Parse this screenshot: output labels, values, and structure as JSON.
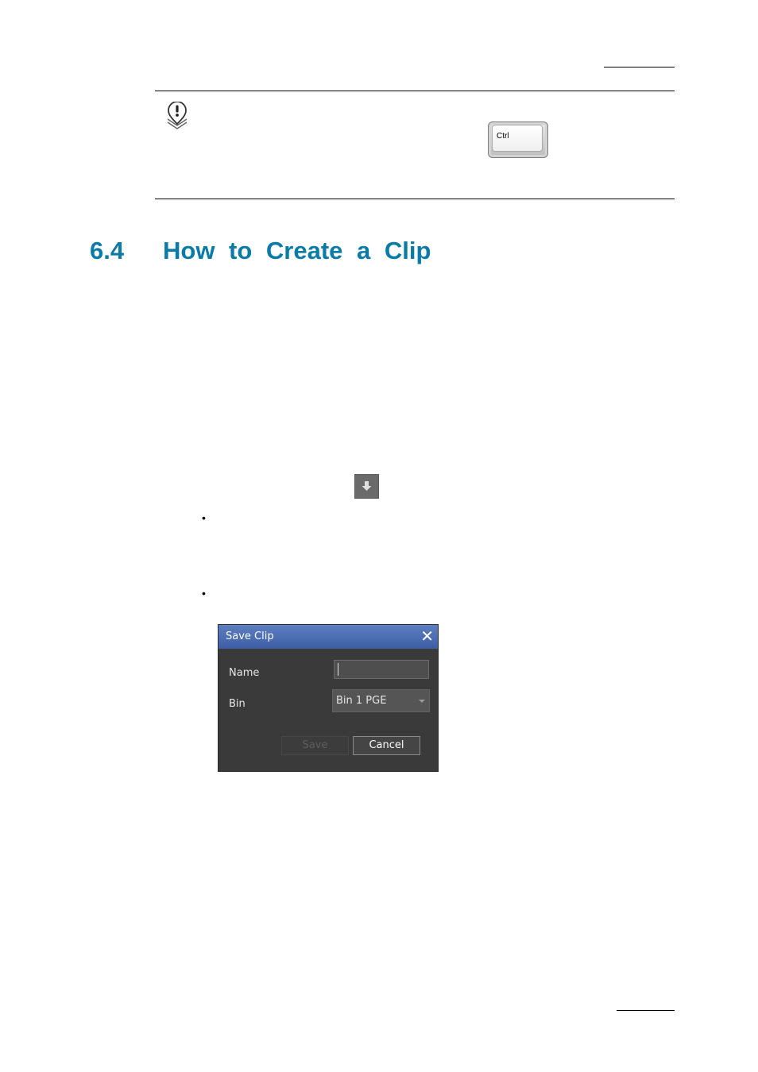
{
  "note": {
    "icon": "note-icon",
    "key_label": "Ctrl"
  },
  "section": {
    "number": "6.4",
    "title": "How to Create a Clip"
  },
  "body": {
    "inline_button_icon": "arrow-down-icon",
    "bullets": [
      "•",
      "•"
    ]
  },
  "dialog": {
    "title": "Save Clip",
    "close_glyph": "✕",
    "name_label": "Name",
    "name_value": "",
    "bin_label": "Bin",
    "bin_value": "Bin 1 PGE",
    "save_label": "Save",
    "cancel_label": "Cancel",
    "colors": {
      "title_bar": "#4a6cb3",
      "body": "#3a3a3a"
    }
  }
}
